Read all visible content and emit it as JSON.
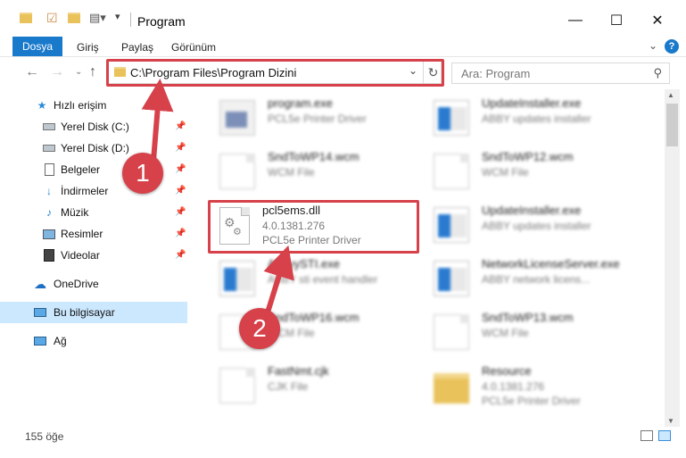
{
  "window": {
    "title": "Program",
    "minimize": "—",
    "maximize": "☐",
    "close": "✕"
  },
  "ribbon": {
    "tabs": [
      "Dosya",
      "Giriş",
      "Paylaş",
      "Görünüm"
    ],
    "help": "?"
  },
  "address": {
    "path": "C:\\Program Files\\Program Dizini"
  },
  "search": {
    "placeholder": "Ara: Program"
  },
  "sidebar": {
    "items": [
      {
        "label": "Hızlı erişim",
        "icon": "star-icon"
      },
      {
        "label": "Yerel Disk (C:)",
        "icon": "drive-icon",
        "pinned": true
      },
      {
        "label": "Yerel Disk (D:)",
        "icon": "drive-icon",
        "pinned": true
      },
      {
        "label": "Belgeler",
        "icon": "documents-icon",
        "pinned": true
      },
      {
        "label": "İndirmeler",
        "icon": "download-icon",
        "pinned": true
      },
      {
        "label": "Müzik",
        "icon": "music-icon",
        "pinned": true
      },
      {
        "label": "Resimler",
        "icon": "pictures-icon",
        "pinned": true
      },
      {
        "label": "Videolar",
        "icon": "videos-icon",
        "pinned": true
      },
      {
        "label": "OneDrive",
        "icon": "cloud-icon"
      },
      {
        "label": "Bu bilgisayar",
        "icon": "computer-icon",
        "selected": true
      },
      {
        "label": "Ağ",
        "icon": "network-icon"
      }
    ]
  },
  "files": [
    {
      "name": "program.exe",
      "line1": "PCL5e Printer Driver",
      "icon": "exe"
    },
    {
      "name": "UpdateInstaller.exe",
      "line1": "ABBY updates installer",
      "icon": "win"
    },
    {
      "name": "SndToWP14.wcm",
      "line1": "WCM File",
      "icon": "doc"
    },
    {
      "name": "SndToWP12.wcm",
      "line1": "WCM File",
      "icon": "doc"
    },
    {
      "name": "pcl5ems.dll",
      "line1": "4.0.1381.276",
      "line2": "PCL5e Printer Driver",
      "icon": "dll",
      "highlighted": true
    },
    {
      "name": "UpdateInstaller.exe",
      "line1": "ABBY updates installer",
      "icon": "win"
    },
    {
      "name": "AbbyySTI.exe",
      "line1": "ABBY sti event handler",
      "icon": "win"
    },
    {
      "name": "NetworkLicenseServer.exe",
      "line1": "ABBY network licens...",
      "icon": "win"
    },
    {
      "name": "SndToWP16.wcm",
      "line1": "WCM File",
      "icon": "doc"
    },
    {
      "name": "SndToWP13.wcm",
      "line1": "WCM File",
      "icon": "doc"
    },
    {
      "name": "FastNmt.cjk",
      "line1": "CJK File",
      "icon": "doc"
    },
    {
      "name": "Resource",
      "line1": "4.0.1381.276",
      "line2": "PCL5e Printer Driver",
      "icon": "folder"
    }
  ],
  "status": {
    "count": "155 öğe"
  },
  "annotations": {
    "step1": "1",
    "step2": "2",
    "color": "#d6414a"
  }
}
